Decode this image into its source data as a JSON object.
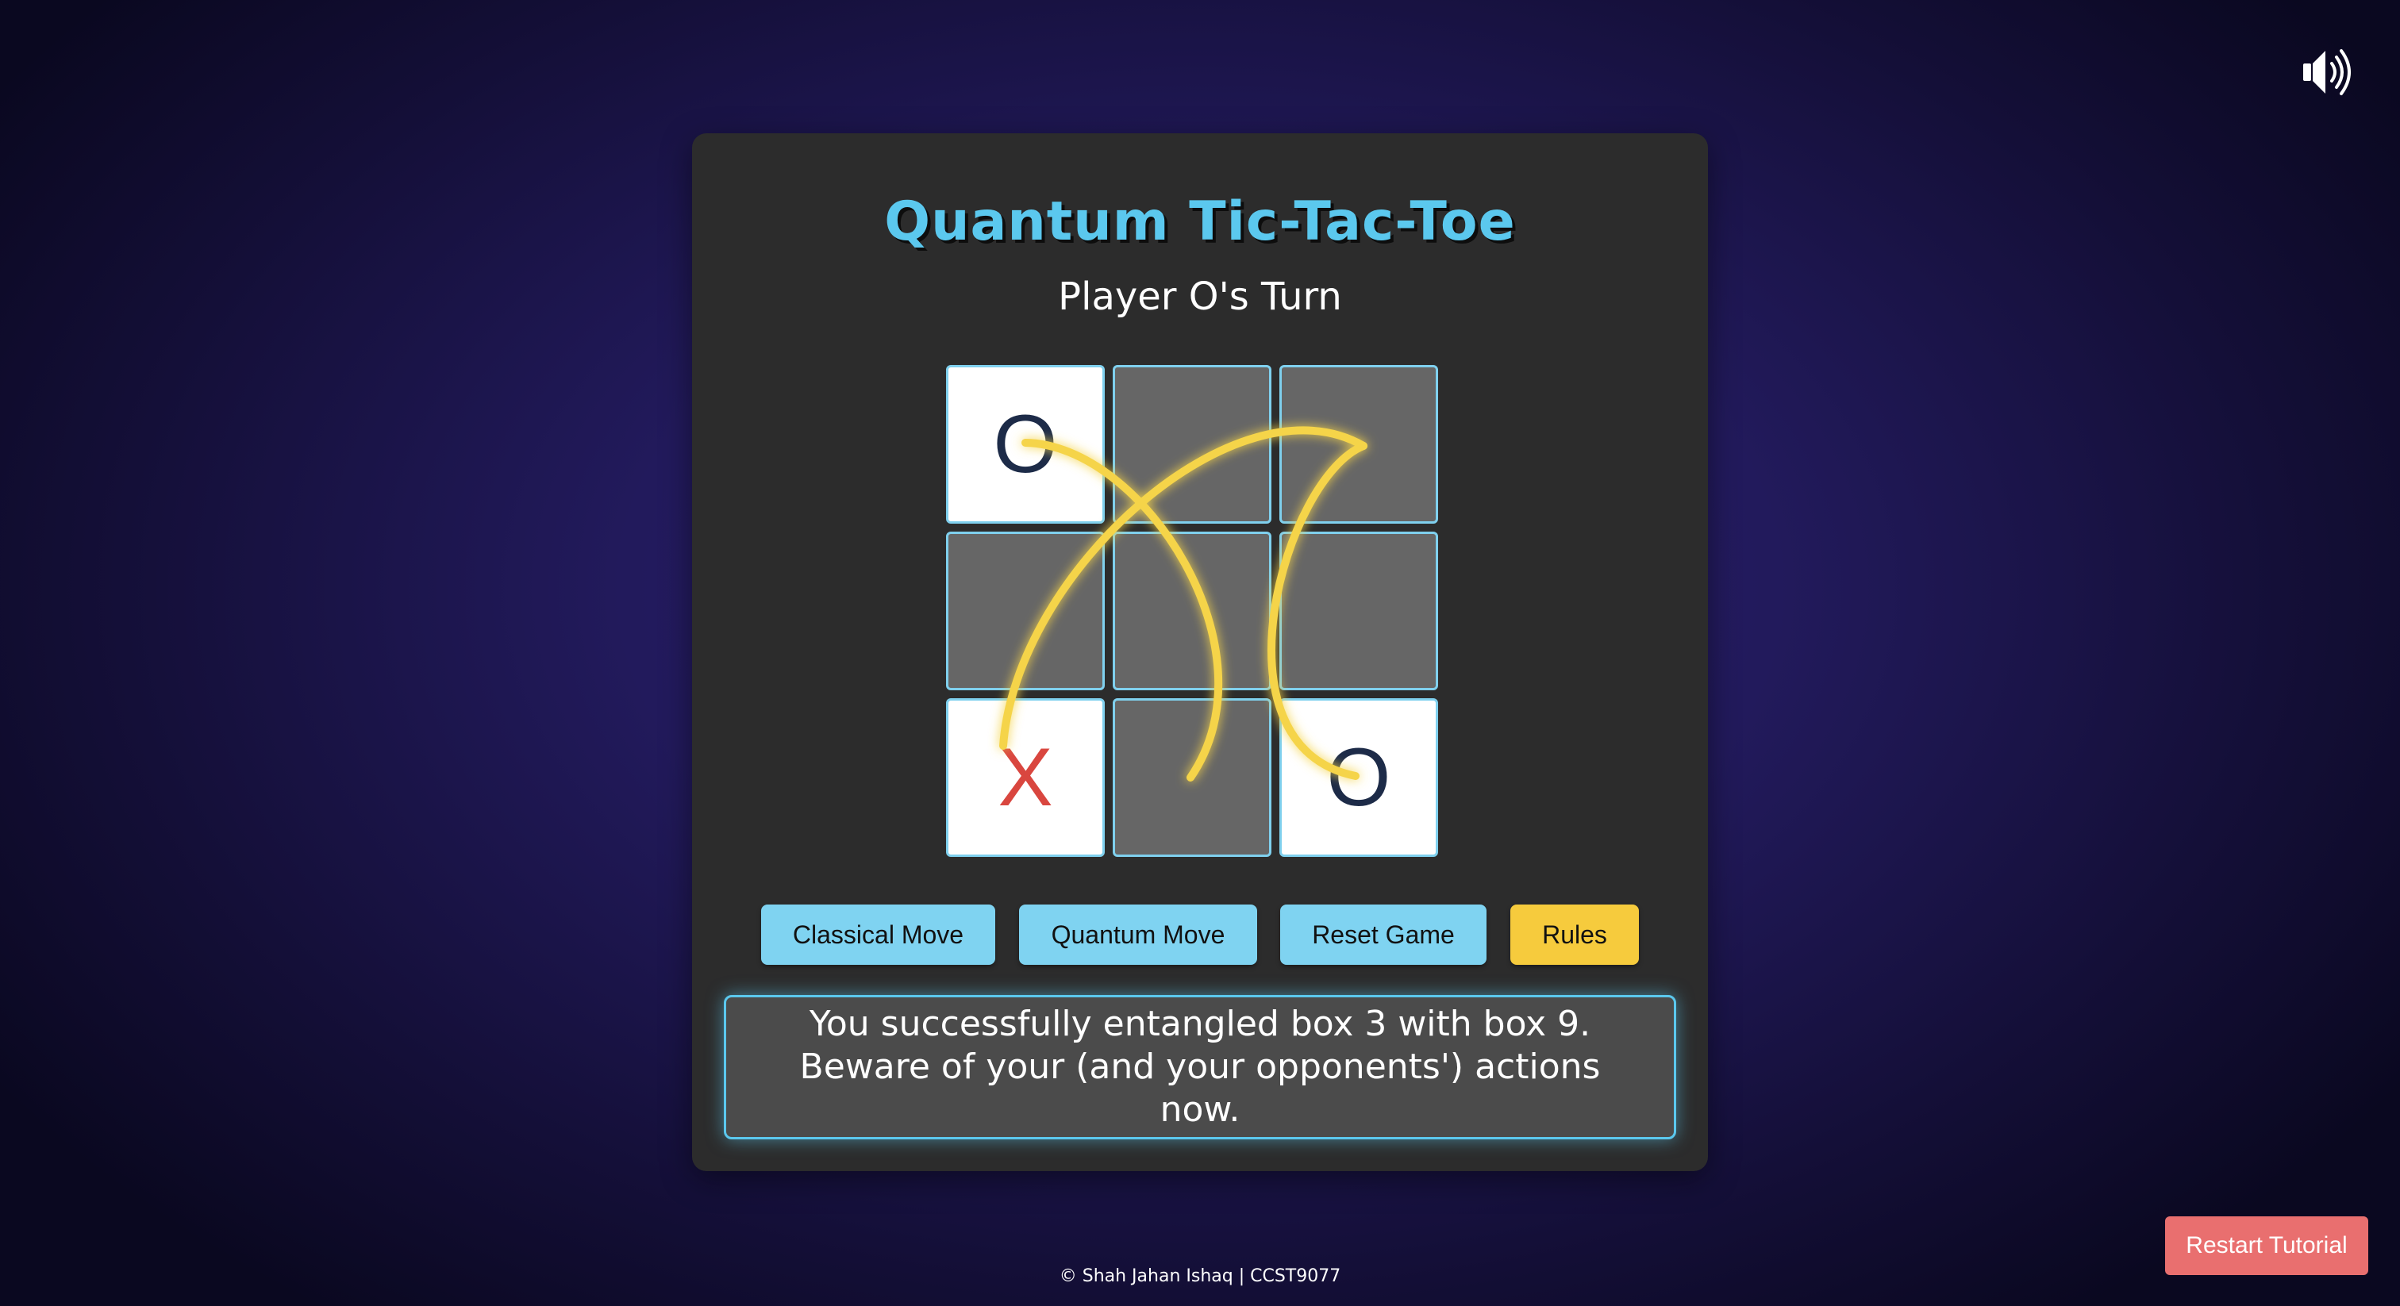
{
  "game": {
    "title": "Quantum Tic-Tac-Toe",
    "turn_text": "Player O's Turn",
    "cells": [
      {
        "box": 1,
        "mark": "O",
        "state": "filled"
      },
      {
        "box": 2,
        "mark": "",
        "state": "empty"
      },
      {
        "box": 3,
        "mark": "",
        "state": "empty"
      },
      {
        "box": 4,
        "mark": "",
        "state": "empty"
      },
      {
        "box": 5,
        "mark": "",
        "state": "empty"
      },
      {
        "box": 6,
        "mark": "",
        "state": "empty"
      },
      {
        "box": 7,
        "mark": "X",
        "state": "filled"
      },
      {
        "box": 8,
        "mark": "",
        "state": "empty"
      },
      {
        "box": 9,
        "mark": "O",
        "state": "filled"
      }
    ],
    "entanglement_color": "#f5d44a"
  },
  "controls": {
    "classical_label": "Classical Move",
    "quantum_label": "Quantum Move",
    "reset_label": "Reset Game",
    "rules_label": "Rules"
  },
  "message": {
    "text": "You successfully entangled box 3 with box 9. Beware of your (and your opponents') actions now."
  },
  "tutorial": {
    "restart_label": "Restart Tutorial"
  },
  "footer": {
    "text": "© Shah Jahan Ishaq | CCST9077"
  },
  "sound": {
    "icon": "speaker-icon"
  },
  "colors": {
    "accent": "#5bc8ee",
    "button": "#7fd3f1",
    "rules_button": "#f6cb3d",
    "restart_button": "#e96f6f",
    "x_mark": "#d9463f",
    "o_mark": "#1d2b48"
  }
}
